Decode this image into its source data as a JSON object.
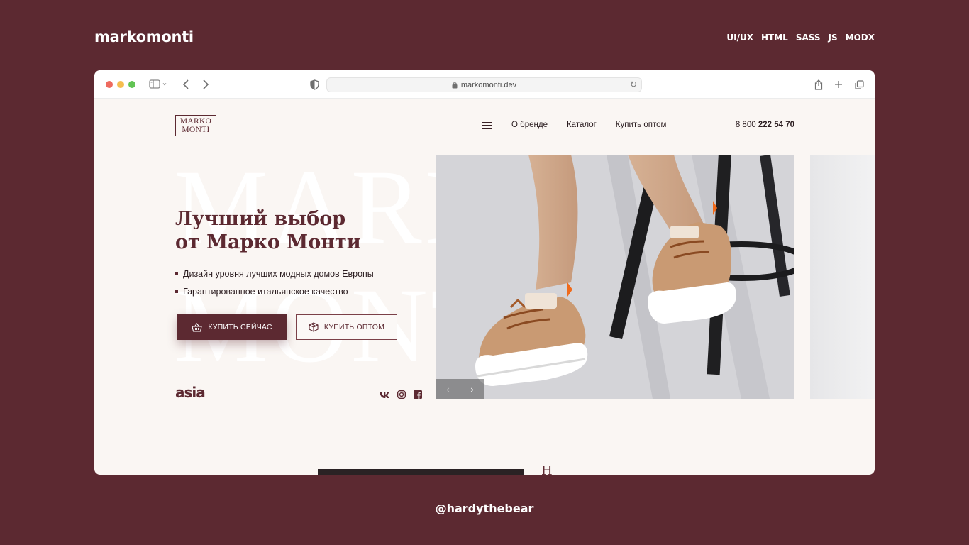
{
  "showcase": {
    "brand": "markomonti",
    "tags": [
      "UI/UX",
      "HTML",
      "SASS",
      "JS",
      "MODX"
    ],
    "handle": "@hardythebear"
  },
  "browser": {
    "url": "markomonti.dev"
  },
  "site": {
    "logo_line1": "MARKO",
    "logo_line2": "MONTI",
    "nav": [
      "О бренде",
      "Каталог",
      "Купить оптом"
    ],
    "phone_prefix": "8 800",
    "phone_main": "222 54 70",
    "bg_word_1": "MARKO",
    "bg_word_2": "MONTI",
    "headline_line1": "Лучший выбор",
    "headline_line2": "от Марко Монти",
    "bullets": [
      "Дизайн уровня лучших модных домов Европы",
      "Гарантированное итальянское качество"
    ],
    "btn_buy_now": "КУПИТЬ СЕЙЧАС",
    "btn_buy_wholesale": "КУПИТЬ ОПТОМ",
    "partner_logo": "asia",
    "slider_prev": "‹",
    "slider_next": "›",
    "peek_title": "Н"
  },
  "colors": {
    "background": "#5c2931",
    "accent": "#5c2931",
    "page": "#faf6f3"
  }
}
